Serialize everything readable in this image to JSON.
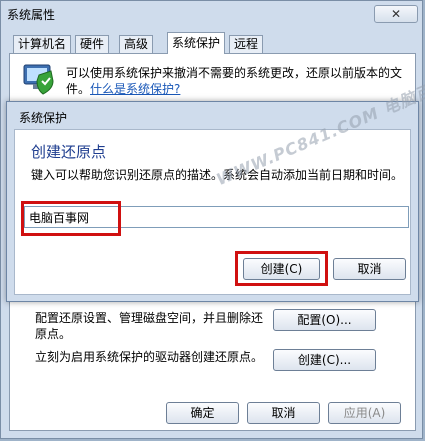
{
  "window": {
    "title": "系统属性",
    "close_label": "✕"
  },
  "tabs": [
    "计算机名",
    "硬件",
    "高级",
    "系统保护",
    "远程"
  ],
  "panel": {
    "description": "可以使用系统保护来撤消不需要的系统更改，还原以前版本的文件。",
    "link": "什么是系统保护?",
    "configure_text": "配置还原设置、管理磁盘空间，并且删除还原点。",
    "configure_button": "配置(O)...",
    "create_text": "立刻为启用系统保护的驱动器创建还原点。",
    "create_button": "创建(C)..."
  },
  "footer": {
    "ok": "确定",
    "cancel": "取消",
    "apply": "应用(A)"
  },
  "dialog": {
    "title": "系统保护",
    "heading": "创建还原点",
    "description": "键入可以帮助您识别还原点的描述。系统会自动添加当前日期和时间。",
    "input_value": "电脑百事网",
    "create_button": "创建(C)",
    "cancel_button": "取消"
  },
  "watermark": "WWW.PC841.COM 电脑百事网",
  "colors": {
    "highlight_border": "#d01010",
    "heading_blue": "#1e3d8f",
    "link_blue": "#1a58b8"
  },
  "icons": [
    "shield-icon",
    "close-icon"
  ]
}
